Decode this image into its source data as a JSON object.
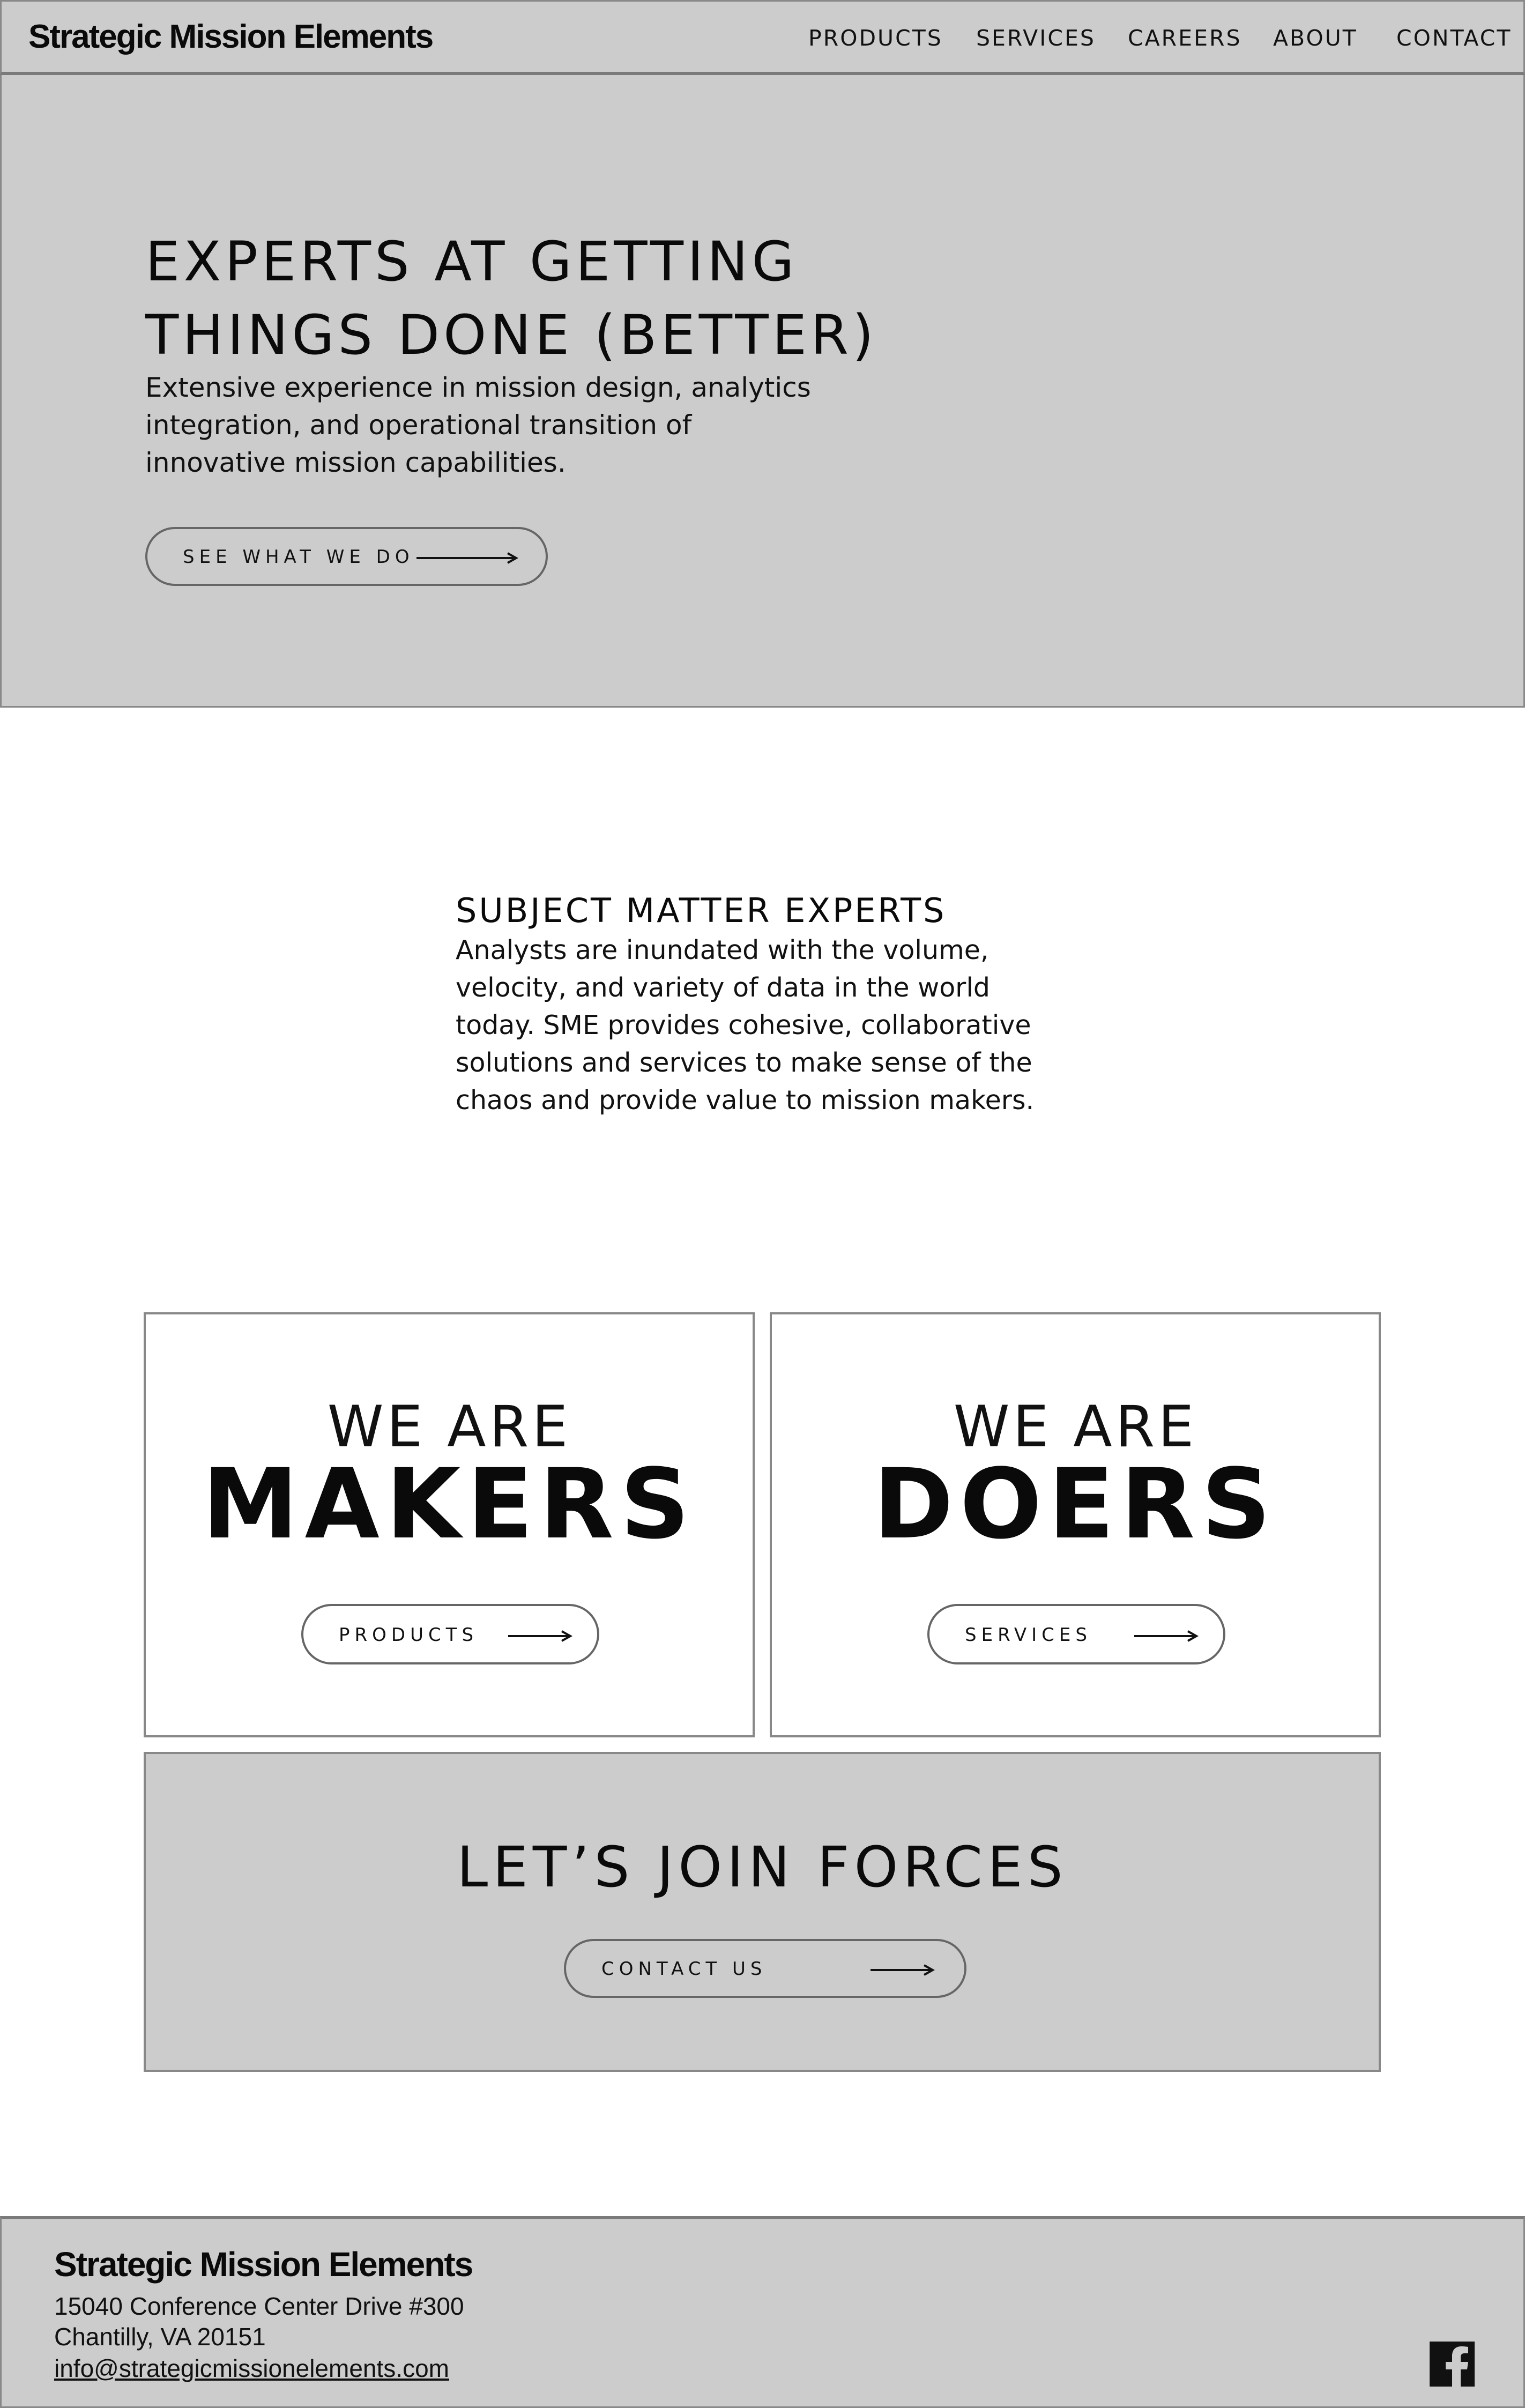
{
  "brand": "Strategic Mission Elements",
  "nav": {
    "products": "PRODUCTS",
    "services": "SERVICES",
    "careers": "CAREERS",
    "about": "ABOUT",
    "contact": "CONTACT"
  },
  "hero": {
    "title_line1": "EXPERTS AT GETTING",
    "title_line2": "THINGS DONE (BETTER)",
    "subtitle": "Extensive experience in mission design, analytics integration, and operational transition of innovative mission capabilities.",
    "cta_label": "SEE WHAT WE DO"
  },
  "sme": {
    "title": "SUBJECT MATTER EXPERTS",
    "text": "Analysts are inundated with the volume, velocity, and variety of data in the world today. SME provides cohesive, collaborative solutions and services to make sense of the chaos and provide value to mission makers."
  },
  "cards": {
    "makers": {
      "we_are": "WE ARE",
      "big": "MAKERS",
      "button": "PRODUCTS"
    },
    "doers": {
      "we_are": "WE ARE",
      "big": "DOERS",
      "button": "SERVICES"
    }
  },
  "join": {
    "title": "LET’S JOIN FORCES",
    "button": "CONTACT US"
  },
  "footer": {
    "brand": "Strategic Mission Elements",
    "address1": "15040 Conference Center Drive #300",
    "address2": "Chantilly, VA 20151",
    "email": "info@strategicmissionelements.com",
    "social_icon": "facebook-icon"
  }
}
